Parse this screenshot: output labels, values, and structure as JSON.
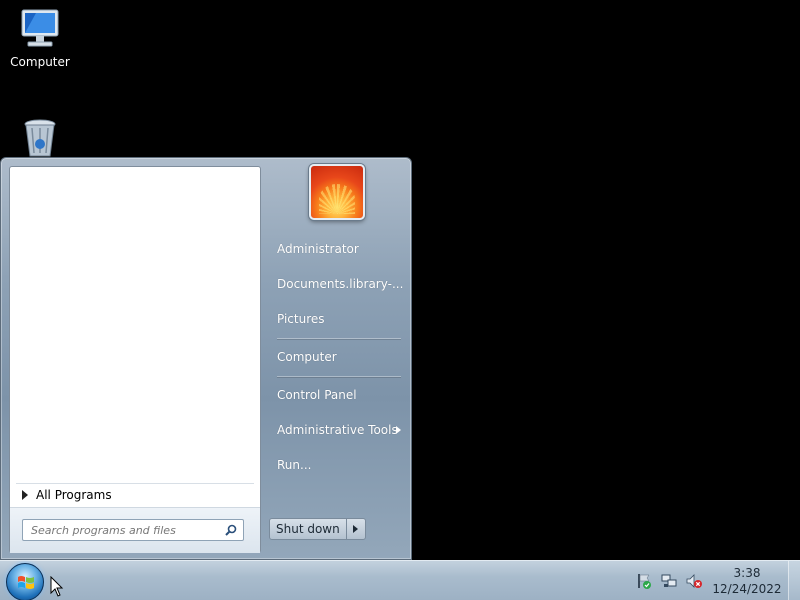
{
  "desktop": {
    "icons": [
      {
        "label": "Computer",
        "icon": "computer-icon"
      },
      {
        "label": "",
        "icon": "recycle-bin-icon"
      }
    ]
  },
  "start_menu": {
    "all_programs": "All Programs",
    "search_placeholder": "Search programs and files",
    "right_items": [
      "Administrator",
      "Documents.library-...",
      "Pictures",
      "Computer",
      "Control Panel",
      "Administrative Tools",
      "Run..."
    ],
    "shutdown_label": "Shut down"
  },
  "taskbar": {
    "clock_time": "3:38",
    "clock_date": "12/24/2022"
  },
  "colors": {
    "accent": "#1d6fb8",
    "menu_text": "#ffffff"
  }
}
